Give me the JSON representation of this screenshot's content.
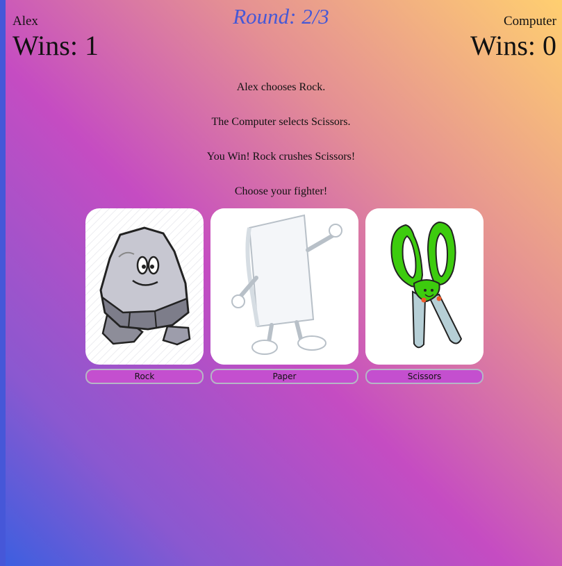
{
  "round": {
    "label": "Round: 2/3"
  },
  "players": {
    "left": {
      "name": "Alex",
      "wins": "Wins: 1"
    },
    "right": {
      "name": "Computer",
      "wins": "Wins: 0"
    }
  },
  "messages": {
    "player_choice": "Alex chooses Rock.",
    "computer_choice": "The Computer selects Scissors.",
    "result": "You Win! Rock crushes Scissors!",
    "prompt": "Choose your fighter!"
  },
  "choices": [
    {
      "label": "Rock",
      "image": "rock-character-icon"
    },
    {
      "label": "Paper",
      "image": "paper-character-icon"
    },
    {
      "label": "Scissors",
      "image": "scissors-character-icon"
    }
  ],
  "colors": {
    "round_text": "#4658d6",
    "button_fill": "#c44fcf",
    "scissors_handle": "#3dcc0e"
  }
}
